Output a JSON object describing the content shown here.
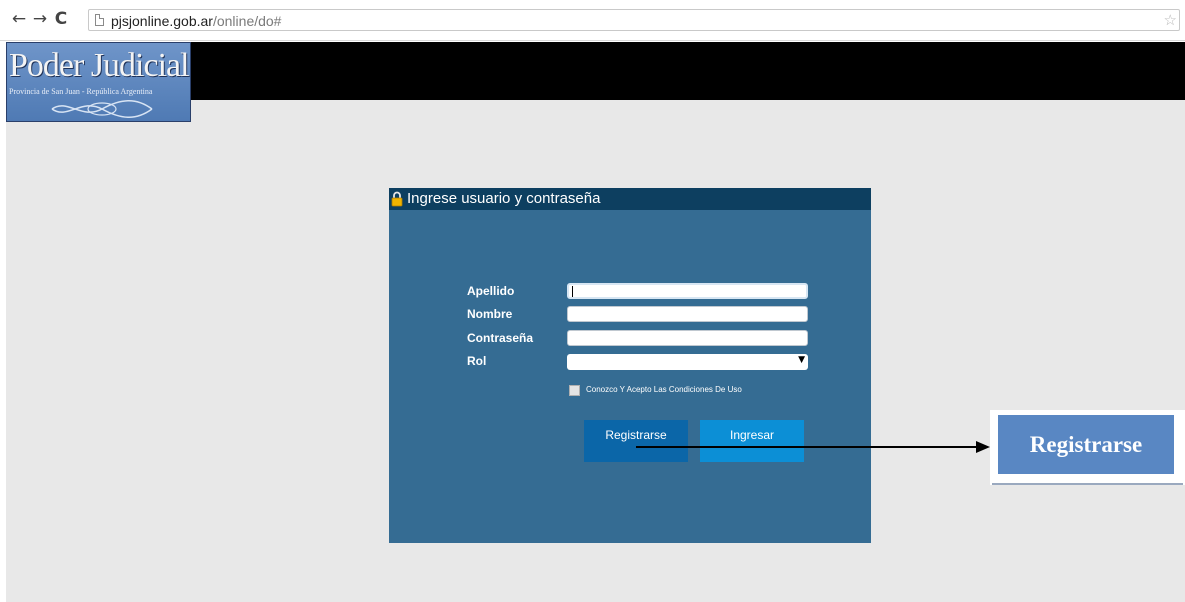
{
  "browser": {
    "url_domain": "pjsjonline.gob.ar",
    "url_path": "/online/do#",
    "nav": {
      "back": "←",
      "forward": "→",
      "reload": "C"
    },
    "star": "☆"
  },
  "logo": {
    "title": "Poder Judicial",
    "subtitle": "Provincia de San Juan - República Argentina"
  },
  "login": {
    "title": "Ingrese usuario y contraseña",
    "fields": {
      "apellido_label": "Apellido",
      "nombre_label": "Nombre",
      "contrasena_label": "Contraseña",
      "rol_label": "Rol",
      "apellido_value": "",
      "nombre_value": "",
      "contrasena_value": "",
      "rol_value": ""
    },
    "terms_label": "Conozco Y Acepto Las Condiciones De Uso",
    "register_button": "Registrarse",
    "login_button": "Ingresar"
  },
  "annotation": {
    "label": "Registrarse"
  },
  "colors": {
    "panel": "#356c93",
    "panel_header": "#0d3f60",
    "register_button": "#0b66a8",
    "login_button": "#0c8fd6",
    "callout": "#5987c3"
  }
}
